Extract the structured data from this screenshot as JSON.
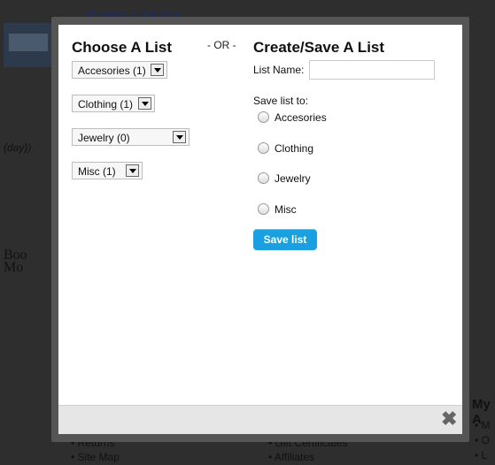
{
  "background": {
    "link_text": "Product > Options",
    "logo_1": "(day))",
    "logo_2_line1": "Boo",
    "logo_2_line2": "Mo",
    "footer_right_heading": "My A",
    "footer_list_1": [
      "Returns",
      "Site Map"
    ],
    "footer_list_2": [
      "Gift Certificates",
      "Affiliates"
    ],
    "footer_list_3": [
      "M",
      "O",
      "L"
    ]
  },
  "modal": {
    "choose_title": "Choose A List",
    "or_separator": "- OR -",
    "create_title": "Create/Save A List",
    "lists": [
      {
        "label": "Accesories (1)"
      },
      {
        "label": "Clothing (1)"
      },
      {
        "label": "Jewelry (0)"
      },
      {
        "label": "Misc (1)"
      }
    ],
    "list_name_label": "List Name:",
    "list_name_value": "",
    "save_to_label": "Save list to:",
    "save_options": [
      {
        "label": "Accesories"
      },
      {
        "label": "Clothing"
      },
      {
        "label": "Jewelry"
      },
      {
        "label": "Misc"
      }
    ],
    "save_button": "Save list",
    "close_glyph": "✖"
  },
  "colors": {
    "accent_button": "#1aa0e0",
    "overlay": "#2e2e2e"
  }
}
